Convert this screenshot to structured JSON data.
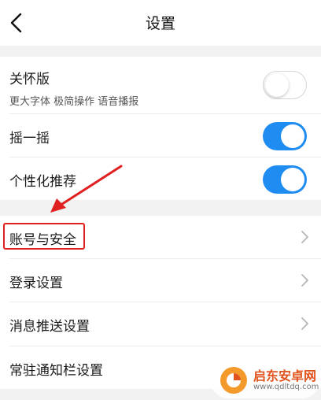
{
  "header": {
    "title": "设置"
  },
  "care_mode": {
    "label": "关怀版",
    "subtitle": "更大字体 极简操作 语音播报",
    "enabled": false
  },
  "shake": {
    "label": "摇一摇",
    "enabled": true
  },
  "personalized": {
    "label": "个性化推荐",
    "enabled": true
  },
  "menu": {
    "account": "账号与安全",
    "login": "登录设置",
    "push": "消息推送设置",
    "notif_bar": "常驻通知栏设置"
  },
  "watermark": {
    "name": "启东安卓网",
    "url": "www.qdltdq.com"
  },
  "colors": {
    "toggle_on": "#1e8cf0",
    "highlight": "#e02020",
    "background": "#f2f2f2"
  }
}
